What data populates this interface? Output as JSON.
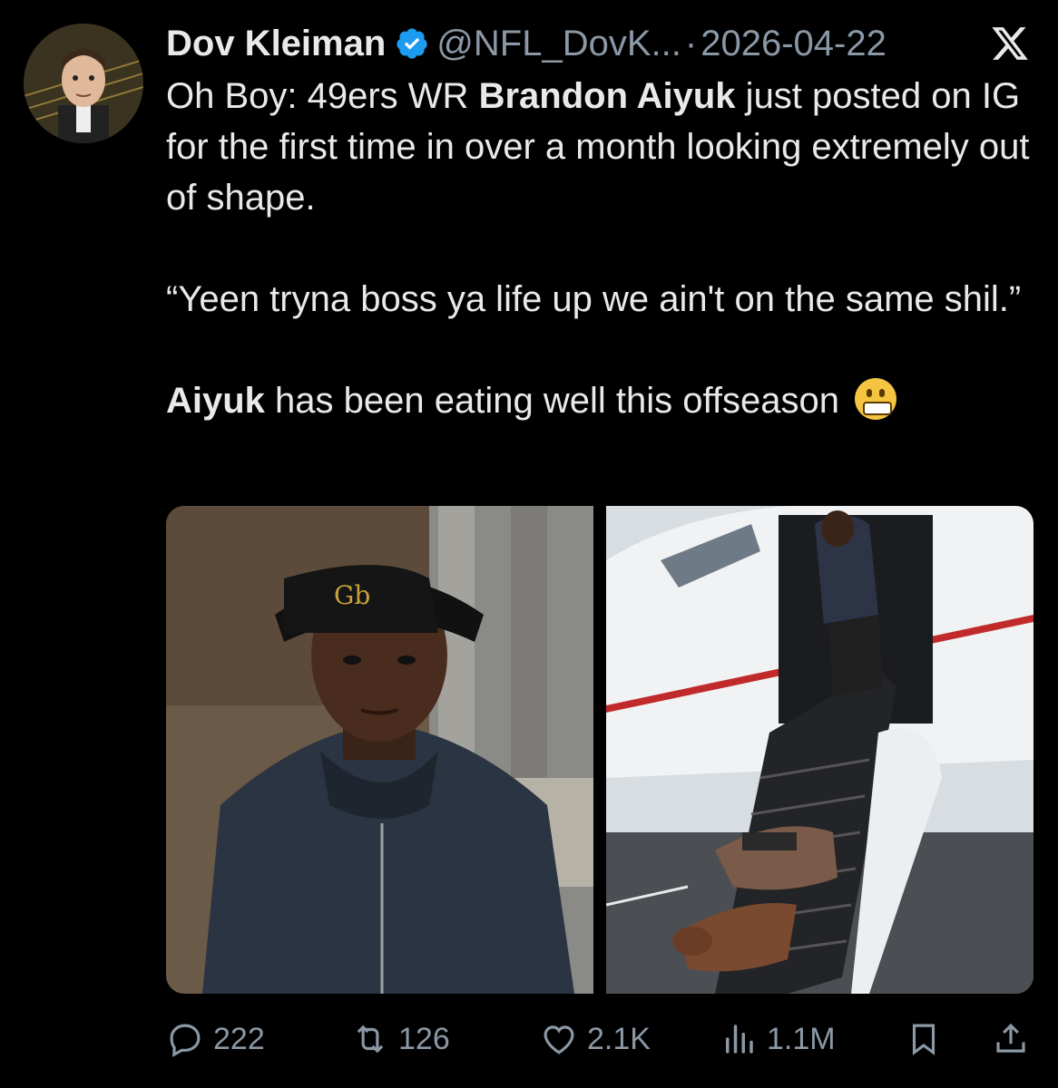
{
  "tweet": {
    "author_name": "Dov Kleiman",
    "handle": "@NFL_DovK...",
    "separator": "·",
    "date": "2026-04-22",
    "line1_pre": "Oh Boy: 49ers WR ",
    "line1_bold": "Brandon Aiyuk",
    "line1_post": " just posted on IG for the first time in over a month looking extremely out of shape.",
    "quote": "“Yeen tryna boss ya life up we ain't on the same shil.”",
    "line3_bold": "Aiyuk",
    "line3_post": " has been eating well this offseason"
  },
  "icons": {
    "verified": "verified-badge-icon",
    "platform": "x-logo-icon",
    "emoji": "grimacing-face-emoji"
  },
  "stats": {
    "replies": "222",
    "reposts": "126",
    "likes": "2.1K",
    "views": "1.1M"
  },
  "colors": {
    "background": "#000000",
    "text": "#e7e9ea",
    "muted": "#8b98a5",
    "verified": "#1d9bf0"
  }
}
